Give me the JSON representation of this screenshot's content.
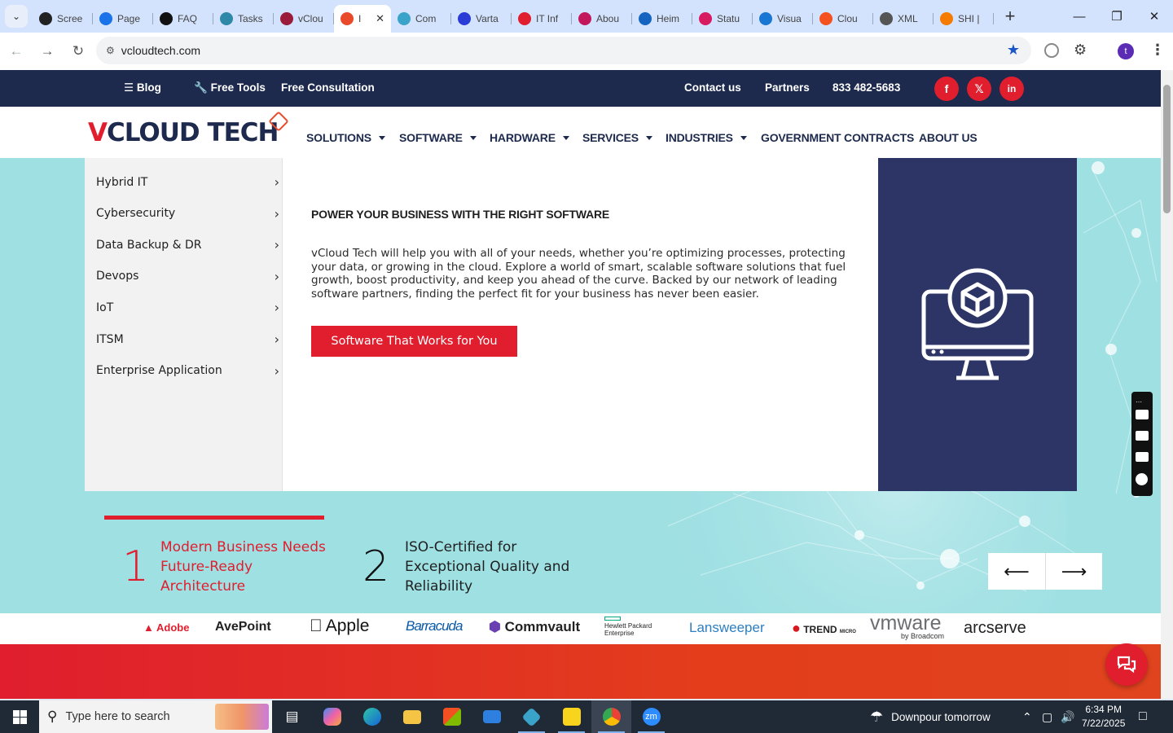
{
  "browser": {
    "tabs": [
      {
        "title": "Scree",
        "color": "#222222"
      },
      {
        "title": "Page",
        "color": "#1a73e8"
      },
      {
        "title": "FAQ",
        "color": "#111111"
      },
      {
        "title": "Tasks",
        "color": "#2e89a8"
      },
      {
        "title": "vClou",
        "color": "#9b1b3b"
      },
      {
        "title": "I",
        "color": "#e84a2a"
      },
      {
        "title": "Com",
        "color": "#3aa3c9"
      },
      {
        "title": "Varta",
        "color": "#2b3bd6"
      },
      {
        "title": "IT Inf",
        "color": "#e01e2e"
      },
      {
        "title": "Abou",
        "color": "#c2185b"
      },
      {
        "title": "Heim",
        "color": "#1565c0"
      },
      {
        "title": "Statu",
        "color": "#d81b60"
      },
      {
        "title": "Visua",
        "color": "#1976d2"
      },
      {
        "title": "Clou",
        "color": "#f4511e"
      },
      {
        "title": "XML",
        "color": "#555555"
      },
      {
        "title": "SHI |",
        "color": "#f57c00"
      }
    ],
    "new_tab": "+",
    "url": "vcloudtech.com",
    "profile_initial": "t"
  },
  "site": {
    "top_links": {
      "blog": "Blog",
      "free_tools": "Free Tools",
      "free_consultation": "Free Consultation",
      "contact": "Contact us",
      "partners": "Partners",
      "phone": "833 482-5683"
    },
    "social": {
      "facebook": "f",
      "x": "𝕏",
      "linkedin": "in"
    },
    "logo": {
      "part1": "V",
      "part2": "CLOUD TECH"
    },
    "menu": [
      "SOLUTIONS",
      "SOFTWARE",
      "HARDWARE",
      "SERVICES",
      "INDUSTRIES",
      "GOVERNMENT CONTRACTS",
      "ABOUT US"
    ],
    "mega": {
      "items": [
        "Hybrid IT",
        "Cybersecurity",
        "Data Backup & DR",
        "Devops",
        "IoT",
        "ITSM",
        "Enterprise Application"
      ],
      "title": "POWER YOUR BUSINESS WITH THE RIGHT SOFTWARE",
      "description": "vCloud Tech will help you with all of your needs, whether you’re optimizing processes, protecting your data, or growing in the cloud. Explore a world of smart, scalable software solutions that fuel growth, boost productivity, and keep you ahead of the curve. Backed by our network of leading software partners, finding the perfect fit for your business has never been easier.",
      "cta": "Software That Works for You"
    },
    "features": [
      {
        "num": "1",
        "text": "Modern Business Needs Future-Ready Architecture"
      },
      {
        "num": "2",
        "text": "ISO-Certified for Exceptional Quality and Reliability"
      }
    ],
    "partners": [
      "Adobe",
      "AvePoint",
      "Apple",
      "Barracuda",
      "Commvault",
      "Hewlett Packard Enterprise",
      "Lansweeper",
      "TREND",
      "vmware",
      "arcserve"
    ],
    "partner_sub": {
      "trend": "MICRO",
      "vmware": "by Broadcom"
    },
    "accent": "#e01e2e",
    "navy": "#1d2a4d"
  },
  "taskbar": {
    "search_placeholder": "Type here to search",
    "weather": "Downpour tomorrow",
    "time": "6:34 PM",
    "date": "7/22/2025"
  }
}
